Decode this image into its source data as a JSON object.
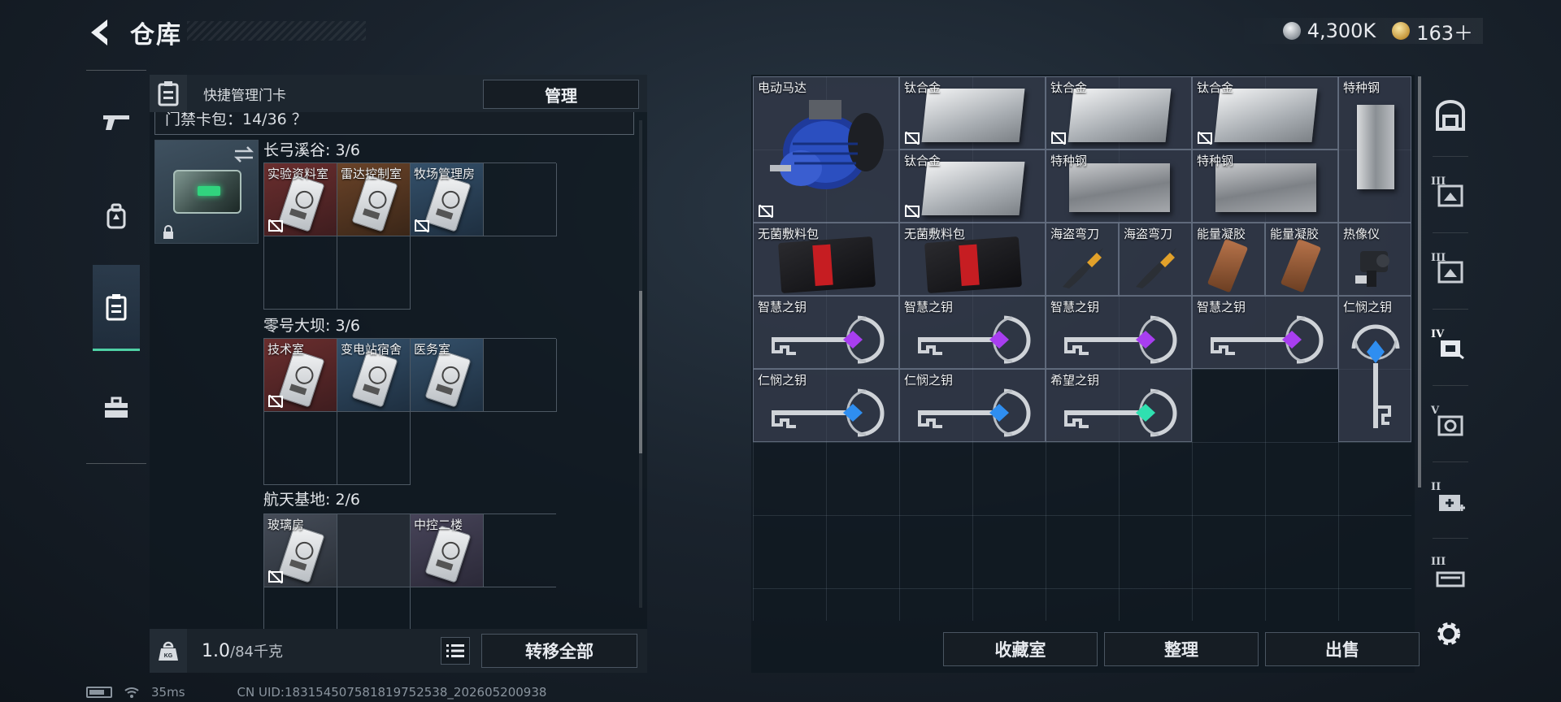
{
  "header": {
    "title": "仓库"
  },
  "currency": {
    "silver": "4,300K",
    "gold": "163＋"
  },
  "quick_manage": {
    "label": "快捷管理门卡",
    "manage_button": "管理",
    "card_pack": "门禁卡包：14/36 ？"
  },
  "zones": [
    {
      "title": "长弓溪谷: 3/6",
      "cards": [
        {
          "name": "实验资料室",
          "color": "c-red"
        },
        {
          "name": "雷达控制室",
          "color": "c-brown"
        },
        {
          "name": "牧场管理房",
          "color": "c-blue"
        }
      ]
    },
    {
      "title": "零号大坝: 3/6",
      "cards": [
        {
          "name": "技术室",
          "color": "c-red"
        },
        {
          "name": "变电站宿舍",
          "color": "c-blue"
        },
        {
          "name": "医务室",
          "color": "c-blue"
        }
      ]
    },
    {
      "title": "航天基地: 2/6",
      "cards": [
        {
          "name": "玻璃房",
          "color": "c-grey"
        },
        {
          "name": "",
          "color": "empty"
        },
        {
          "name": "中控二楼",
          "color": "c-violet"
        }
      ]
    }
  ],
  "weight": {
    "current": "1.0",
    "max": "/84千克"
  },
  "buttons": {
    "transfer_all": "转移全部",
    "collection_room": "收藏室",
    "sort": "整理",
    "sell": "出售"
  },
  "inventory": {
    "motor": "电动马达",
    "titanium": "钛合金",
    "special_steel": "特种钢",
    "sterile_bandage": "无菌敷料包",
    "pirate_knife": "海盗弯刀",
    "energy_gel": "能量凝胶",
    "thermal_imager": "热像仪",
    "wisdom_key": "智慧之钥",
    "mercy_key": "仁悯之钥",
    "hope_key": "希望之钥"
  },
  "side_tabs": [
    {
      "roman": "",
      "icon": "safe-box-icon"
    },
    {
      "roman": "III",
      "icon": "photo-crate-icon"
    },
    {
      "roman": "III",
      "icon": "photo-crate-icon"
    },
    {
      "roman": "IV",
      "icon": "hand-card-icon"
    },
    {
      "roman": "V",
      "icon": "camera-crate-icon"
    },
    {
      "roman": "II",
      "icon": "medical-crate-icon"
    },
    {
      "roman": "III",
      "icon": "gun-crate-icon"
    }
  ],
  "status": {
    "ping": "35ms",
    "uid": "CN UID:183154507581819752538_202605200938"
  },
  "colors": {
    "accent_green": "#4fd1a5",
    "panel_bg": "#101820"
  }
}
